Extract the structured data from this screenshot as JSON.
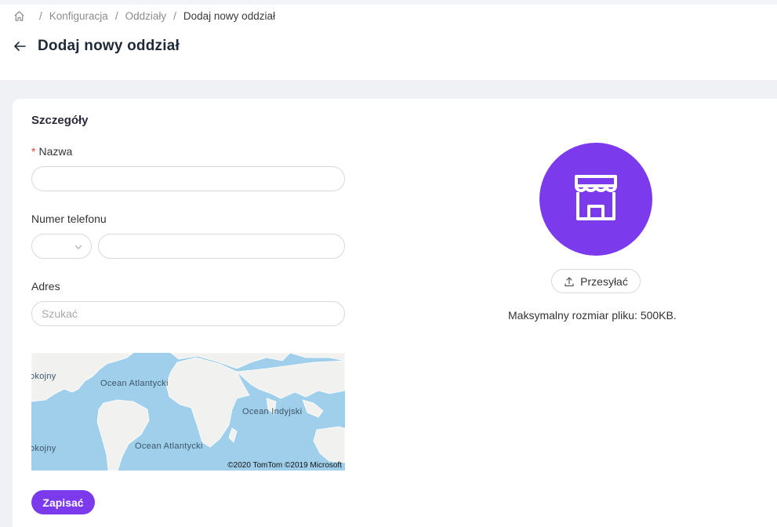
{
  "breadcrumb": {
    "items": [
      "Konfiguracja",
      "Oddziały",
      "Dodaj nowy oddział"
    ],
    "separator": "/"
  },
  "header": {
    "title": "Dodaj nowy oddział"
  },
  "form": {
    "section_title": "Szczegóły",
    "name": {
      "required_mark": "*",
      "label": "Nazwa",
      "value": "",
      "placeholder": ""
    },
    "phone": {
      "label": "Numer telefonu",
      "country_code": "",
      "value": ""
    },
    "address": {
      "label": "Adres",
      "placeholder": "Szukać",
      "value": ""
    },
    "save_label": "Zapisać"
  },
  "map": {
    "labels": {
      "atlantic_north": "Ocean Atlantycki",
      "atlantic_south": "Ocean Atlantycki",
      "indian": "Ocean Indyjski",
      "pacific_north": "okojny",
      "pacific_south": "okojny"
    },
    "copyright": "©2020 TomTom ©2019 Microsoft"
  },
  "upload": {
    "button_label": "Przesyłać",
    "hint": "Maksymalny rozmiar pliku: 500KB."
  },
  "icons": [
    "home-icon",
    "back-arrow-icon",
    "chevron-down-icon",
    "store-icon",
    "upload-icon"
  ],
  "colors": {
    "accent": "#7c3aed",
    "page_background": "#f0f1f5",
    "required": "#e0452d",
    "ocean": "#9fcfea",
    "land": "#f1f1ef"
  }
}
